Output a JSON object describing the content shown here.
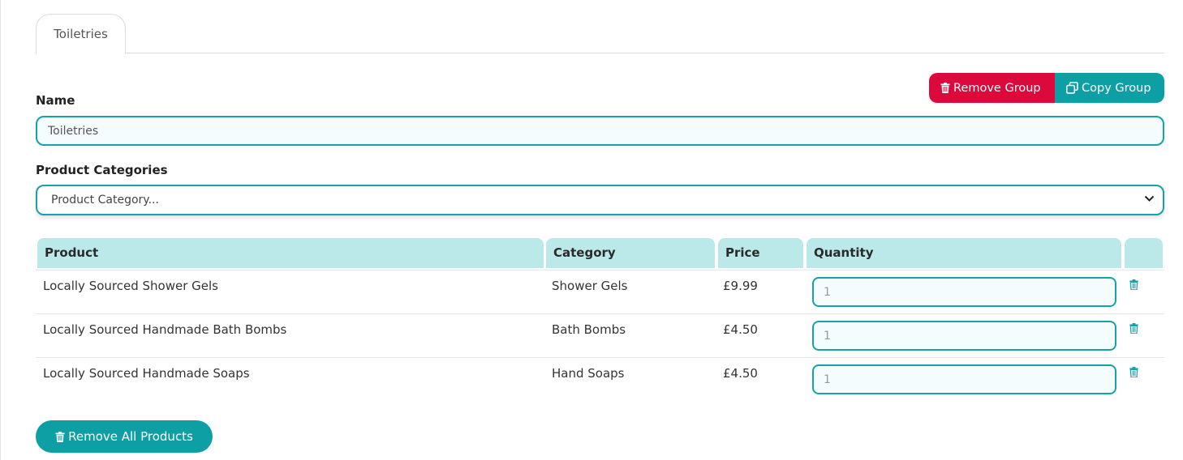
{
  "tabs": [
    {
      "label": "Toiletries"
    }
  ],
  "group_actions": {
    "remove_label": "Remove Group",
    "copy_label": "Copy Group"
  },
  "name_field": {
    "label": "Name",
    "value": "Toiletries"
  },
  "categories_field": {
    "label": "Product Categories",
    "placeholder": "Product Category..."
  },
  "table": {
    "headers": {
      "product": "Product",
      "category": "Category",
      "price": "Price",
      "quantity": "Quantity"
    },
    "rows": [
      {
        "product": "Locally Sourced Shower Gels",
        "category": "Shower Gels",
        "price": "£9.99",
        "quantity": "1"
      },
      {
        "product": "Locally Sourced Handmade Bath Bombs",
        "category": "Bath Bombs",
        "price": "£4.50",
        "quantity": "1"
      },
      {
        "product": "Locally Sourced Handmade Soaps",
        "category": "Hand Soaps",
        "price": "£4.50",
        "quantity": "1"
      }
    ]
  },
  "footer": {
    "remove_all_label": "Remove All Products"
  },
  "colors": {
    "accent": "#0e9fa5",
    "danger": "#dc0a3c",
    "header_bg": "#bbe9ea"
  },
  "icons": {
    "trash": "trash-icon",
    "copy": "copy-icon",
    "chevron": "chevron-down-icon"
  }
}
